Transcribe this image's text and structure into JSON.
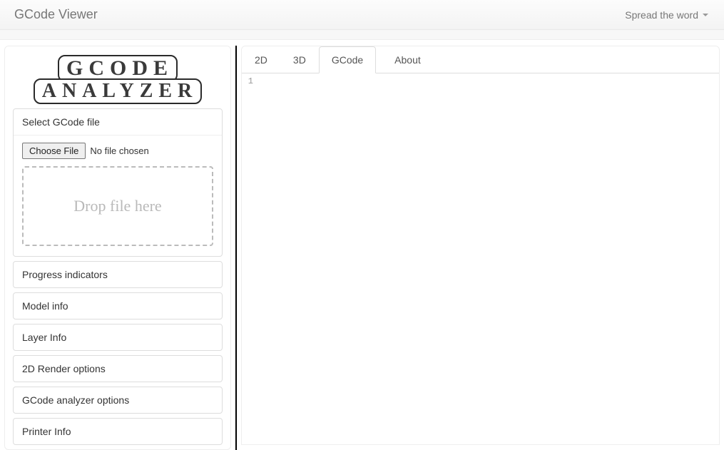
{
  "navbar": {
    "title": "GCode Viewer",
    "menu_label": "Spread the word"
  },
  "logo": {
    "line1": "GCODE",
    "line2": "ANALYZER"
  },
  "file_panel": {
    "heading": "Select GCode file",
    "choose_button": "Choose File",
    "status": "No file chosen",
    "dropzone_text": "Drop file here"
  },
  "sidebar_panels": [
    "Progress indicators",
    "Model info",
    "Layer Info",
    "2D Render options",
    "GCode analyzer options",
    "Printer Info"
  ],
  "tabs": {
    "items": [
      "2D",
      "3D",
      "GCode",
      "About"
    ],
    "active_index": 2
  },
  "editor": {
    "first_line_number": "1"
  }
}
